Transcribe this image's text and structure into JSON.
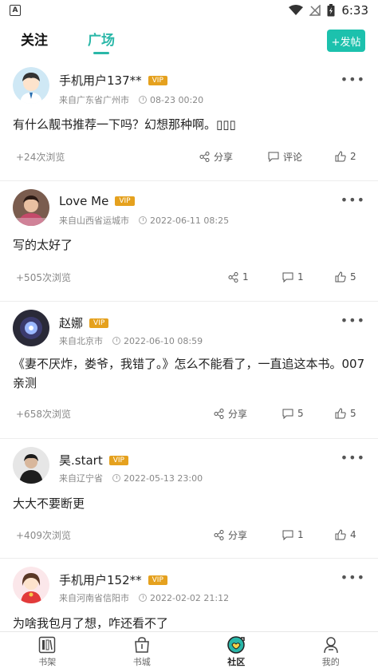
{
  "status_bar": {
    "time": "6:33"
  },
  "tabs": {
    "follow": "关注",
    "square": "广场"
  },
  "post_button": "+发帖",
  "posts": [
    {
      "username": "手机用户137**",
      "vip": "VIP",
      "location": "来自广东省广州市",
      "time": "08-23 00:20",
      "content": "有什么靓书推荐一下吗？幻想那种啊。▯▯▯",
      "views": "+24次浏览",
      "share": "分享",
      "comment": "评论",
      "likes": "2"
    },
    {
      "username": "Love Me",
      "vip": "VIP",
      "location": "来自山西省运城市",
      "time": "2022-06-11 08:25",
      "content": "写的太好了",
      "views": "+505次浏览",
      "share": "1",
      "comment": "1",
      "likes": "5"
    },
    {
      "username": "赵娜",
      "vip": "VIP",
      "location": "来自北京市",
      "time": "2022-06-10 08:59",
      "content": "《妻不厌炸，娄爷，我错了。》怎么不能看了，一直追这本书。007亲测",
      "views": "+658次浏览",
      "share": "分享",
      "comment": "5",
      "likes": "5"
    },
    {
      "username": "昊.start",
      "vip": "VIP",
      "location": "来自辽宁省",
      "time": "2022-05-13 23:00",
      "content": "大大不要断更",
      "views": "+409次浏览",
      "share": "分享",
      "comment": "1",
      "likes": "4"
    },
    {
      "username": "手机用户152**",
      "vip": "VIP",
      "location": "来自河南省信阳市",
      "time": "2022-02-02 21:12",
      "content": "为啥我包月了想，咋还看不了",
      "views": "",
      "share": "",
      "comment": "",
      "likes": ""
    }
  ],
  "bottom_nav": [
    {
      "label": "书架",
      "icon": "bookshelf-icon"
    },
    {
      "label": "书城",
      "icon": "bookstore-icon"
    },
    {
      "label": "社区",
      "icon": "community-icon"
    },
    {
      "label": "我的",
      "icon": "profile-icon"
    }
  ],
  "colors": {
    "accent": "#2ab7a8",
    "post_button": "#1cc1ad",
    "vip": "#e5a11e"
  }
}
